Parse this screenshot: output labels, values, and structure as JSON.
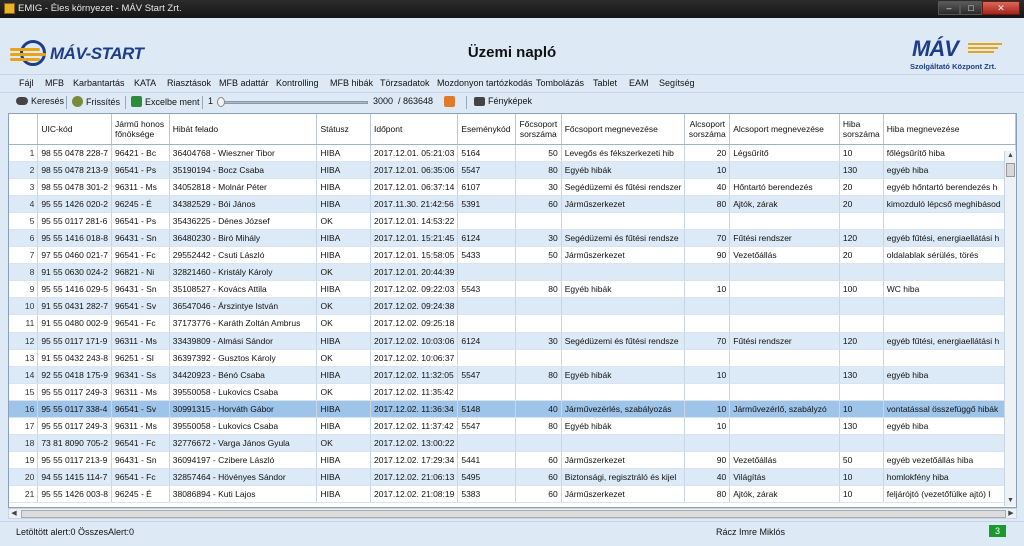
{
  "window": {
    "title": "EMIG - Éles környezet - MÁV Start Zrt."
  },
  "header": {
    "brand_left": "MÁV-START",
    "title": "Üzemi napló",
    "brand_right": "MÁV",
    "brand_right_sub": "Szolgáltató Központ Zrt."
  },
  "menu": [
    "Fájl",
    "MFB",
    "Karbantartás",
    "KATA",
    "Riasztások",
    "MFB adattár",
    "Kontrolling",
    "MFB hibák",
    "Törzsadatok",
    "Mozdonyon tartózkodás",
    "Tombolázás",
    "Tablet",
    "EAM",
    "Segítség"
  ],
  "toolbar": {
    "search": "Keresés",
    "refresh": "Frissítés",
    "excel": "Excelbe ment",
    "slider_min": "1",
    "slider_value": "3000",
    "slider_total": "/ 863648",
    "photos": "Fényképek"
  },
  "columns": [
    "",
    "UIC-kód",
    "Jármű honos főnöksége",
    "Hibát felado",
    "Státusz",
    "Időpont",
    "Eseménykód",
    "Főcsoport sorszáma",
    "Főcsoport megnevezése",
    "Alcsoport sorszáma",
    "Alcsoport megnevezése",
    "Hiba sorszáma",
    "Hiba megnevezése"
  ],
  "rows": [
    [
      "1",
      "98 55 0478 228-7",
      "96421 - Bc",
      "36404768 - Wieszner Tibor",
      "HIBA",
      "2017.12.01. 05:21:03",
      "5164",
      "50",
      "Levegős és fékszerkezeti hib",
      "20",
      "Légsűrítő",
      "10",
      "főlégsűrítő hiba"
    ],
    [
      "2",
      "98 55 0478 213-9",
      "96541 - Ps",
      "35190194 - Bocz Csaba",
      "HIBA",
      "2017.12.01. 06:35:06",
      "5547",
      "80",
      "Egyéb hibák",
      "10",
      "",
      "130",
      "egyéb hiba"
    ],
    [
      "3",
      "98 55 0478 301-2",
      "96311 - Ms",
      "34052818 - Molnár Péter",
      "HIBA",
      "2017.12.01. 06:37:14",
      "6107",
      "30",
      "Segédüzemi és fűtési rendszer",
      "40",
      "Hőntartó berendezés",
      "20",
      "egyéb hőntartó berendezés h"
    ],
    [
      "4",
      "95 55 1426 020-2",
      "96245 - É",
      "34382529 - Bói János",
      "HIBA",
      "2017.11.30. 21:42:56",
      "5391",
      "60",
      "Járműszerkezet",
      "80",
      "Ajtók, zárak",
      "20",
      "kimozduló lépcső meghibásod"
    ],
    [
      "5",
      "95 55 0117 281-6",
      "96541 - Ps",
      "35436225 - Dénes József",
      "OK",
      "2017.12.01. 14:53:22",
      "",
      "",
      "",
      "",
      "",
      "",
      ""
    ],
    [
      "6",
      "95 55 1416 018-8",
      "96431 - Sn",
      "36480230 - Biró Mihály",
      "HIBA",
      "2017.12.01. 15:21:45",
      "6124",
      "30",
      "Segédüzemi és fűtési rendsze",
      "70",
      "Fűtési rendszer",
      "120",
      "egyéb fűtési, energiaellátási h"
    ],
    [
      "7",
      "97 55 0460 021-7",
      "96541 - Fc",
      "29552442 - Csuti László",
      "HIBA",
      "2017.12.01. 15:58:05",
      "5433",
      "50",
      "Járműszerkezet",
      "90",
      "Vezetőállás",
      "20",
      "oldalablak sérülés, törés"
    ],
    [
      "8",
      "91 55 0630 024-2",
      "96821 - Ni",
      "32821460 - Kristály Károly",
      "OK",
      "2017.12.01. 20:44:39",
      "",
      "",
      "",
      "",
      "",
      "",
      ""
    ],
    [
      "9",
      "95 55 1416 029-5",
      "96431 - Sn",
      "35108527 - Kovács Attila",
      "HIBA",
      "2017.12.02. 09:22:03",
      "5543",
      "80",
      "Egyéb hibák",
      "10",
      "",
      "100",
      "WC hiba"
    ],
    [
      "10",
      "91 55 0431 282-7",
      "96541 - Sv",
      "36547046 - Árszintye István",
      "OK",
      "2017.12.02. 09:24:38",
      "",
      "",
      "",
      "",
      "",
      "",
      ""
    ],
    [
      "11",
      "91 55 0480 002-9",
      "96541 - Fc",
      "37173776 - Karáth Zoltán Ambrus",
      "OK",
      "2017.12.02. 09:25:18",
      "",
      "",
      "",
      "",
      "",
      "",
      ""
    ],
    [
      "12",
      "95 55 0117 171-9",
      "96311 - Ms",
      "33439809 - Almási Sándor",
      "HIBA",
      "2017.12.02. 10:03:06",
      "6124",
      "30",
      "Segédüzemi és fűtési rendsze",
      "70",
      "Fűtési rendszer",
      "120",
      "egyéb fűtési, energiaellátási h"
    ],
    [
      "13",
      "91 55 0432 243-8",
      "96251 - Sl",
      "36397392 - Gusztos Károly",
      "OK",
      "2017.12.02. 10:06:37",
      "",
      "",
      "",
      "",
      "",
      "",
      ""
    ],
    [
      "14",
      "92 55 0418 175-9",
      "96341 - Ss",
      "34420923 - Bénó Csaba",
      "HIBA",
      "2017.12.02. 11:32:05",
      "5547",
      "80",
      "Egyéb hibák",
      "10",
      "",
      "130",
      "egyéb hiba"
    ],
    [
      "15",
      "95 55 0117 249-3",
      "96311 - Ms",
      "39550058 - Lukovics Csaba",
      "OK",
      "2017.12.02. 11:35:42",
      "",
      "",
      "",
      "",
      "",
      "",
      ""
    ],
    [
      "16",
      "95 55 0117 338-4",
      "96541 - Sv",
      "30991315 - Horváth Gábor",
      "HIBA",
      "2017.12.02. 11:36:34",
      "5148",
      "40",
      "Járművezérlés, szabályozás",
      "10",
      "Járművezérlő, szabályzó",
      "10",
      "vontatással összefüggő hibák"
    ],
    [
      "17",
      "95 55 0117 249-3",
      "96311 - Ms",
      "39550058 - Lukovics Csaba",
      "HIBA",
      "2017.12.02. 11:37:42",
      "5547",
      "80",
      "Egyéb hibák",
      "10",
      "",
      "130",
      "egyéb hiba"
    ],
    [
      "18",
      "73 81 8090 705-2",
      "96541 - Fc",
      "32776672 - Varga János Gyula",
      "OK",
      "2017.12.02. 13:00:22",
      "",
      "",
      "",
      "",
      "",
      "",
      ""
    ],
    [
      "19",
      "95 55 0117 213-9",
      "96431 - Sn",
      "36094197 - Czibere László",
      "HIBA",
      "2017.12.02. 17:29:34",
      "5441",
      "60",
      "Járműszerkezet",
      "90",
      "Vezetőállás",
      "50",
      "egyéb vezetőállás hiba"
    ],
    [
      "20",
      "94 55 1415 114-7",
      "96541 - Fc",
      "32857464 - Hövényes Sándor",
      "HIBA",
      "2017.12.02. 21:06:13",
      "5495",
      "60",
      "Biztonsági, regisztráló és kijel",
      "40",
      "Világítás",
      "10",
      "homlokfény hiba"
    ],
    [
      "21",
      "95 55 1426 003-8",
      "96245 - É",
      "38086894 - Kuti Lajos",
      "HIBA",
      "2017.12.02. 21:08:19",
      "5383",
      "60",
      "Járműszerkezet",
      "80",
      "Ajtók, zárak",
      "10",
      "feljárójtó (vezetőfülke ajtó) l"
    ]
  ],
  "selected_row": "16",
  "status": {
    "alerts": "Letöltött alert:0 ÖsszesAlert:0",
    "user": "Rácz Imre Miklós",
    "badge": "3"
  },
  "colors": {
    "row_even": "#dce9f6",
    "row_selected": "#9ec4ea",
    "brand_blue": "#1d3d8a",
    "brand_orange": "#e8a317",
    "badge": "#1a9a2a"
  }
}
